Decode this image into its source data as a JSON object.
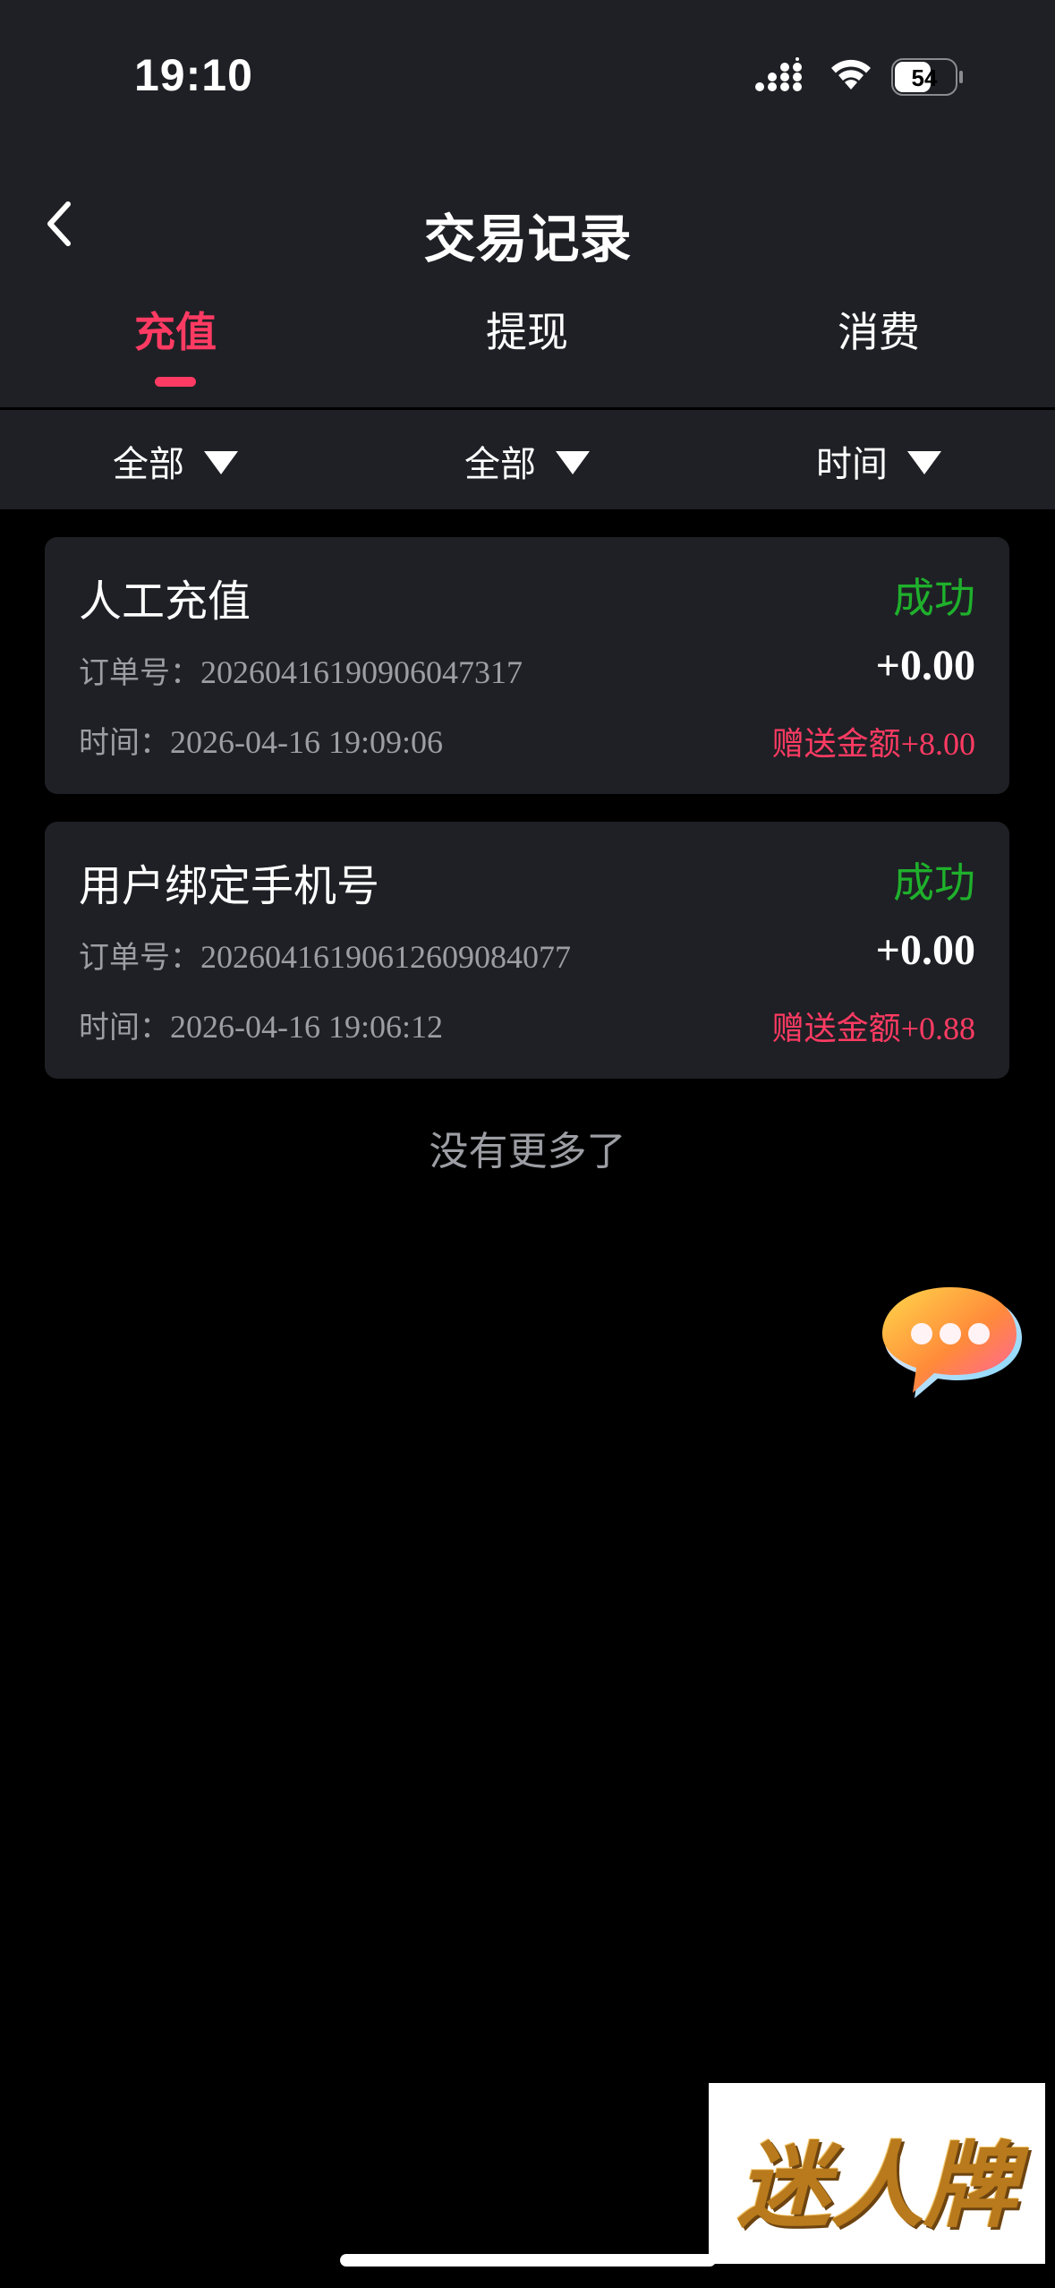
{
  "status_bar": {
    "time": "19:10",
    "battery": "54"
  },
  "nav": {
    "title": "交易记录"
  },
  "tabs": [
    {
      "label": "充值",
      "active": true
    },
    {
      "label": "提现",
      "active": false
    },
    {
      "label": "消费",
      "active": false
    }
  ],
  "filters": [
    {
      "label": "全部"
    },
    {
      "label": "全部"
    },
    {
      "label": "时间"
    }
  ],
  "records": [
    {
      "title": "人工充值",
      "status": "成功",
      "order_label": "订单号：",
      "order_no": "20260416190906047317",
      "amount": "+0.00",
      "time_label": "时间：",
      "time": "2026-04-16 19:09:06",
      "bonus_label": "赠送金额",
      "bonus": "+8.00"
    },
    {
      "title": "用户绑定手机号",
      "status": "成功",
      "order_label": "订单号：",
      "order_no": "20260416190612609084077",
      "amount": "+0.00",
      "time_label": "时间：",
      "time": "2026-04-16 19:06:12",
      "bonus_label": "赠送金额",
      "bonus": "+0.88"
    }
  ],
  "list_end": "没有更多了",
  "watermark": "迷人牌",
  "colors": {
    "accent": "#ff3b63",
    "success": "#1fb02c",
    "panel": "#1f2025",
    "muted": "#9c9ea4"
  },
  "icons": {
    "back": "chevron-left-icon",
    "filter_arrow": "triangle-down-icon",
    "chat": "chat-bubble-icon"
  }
}
